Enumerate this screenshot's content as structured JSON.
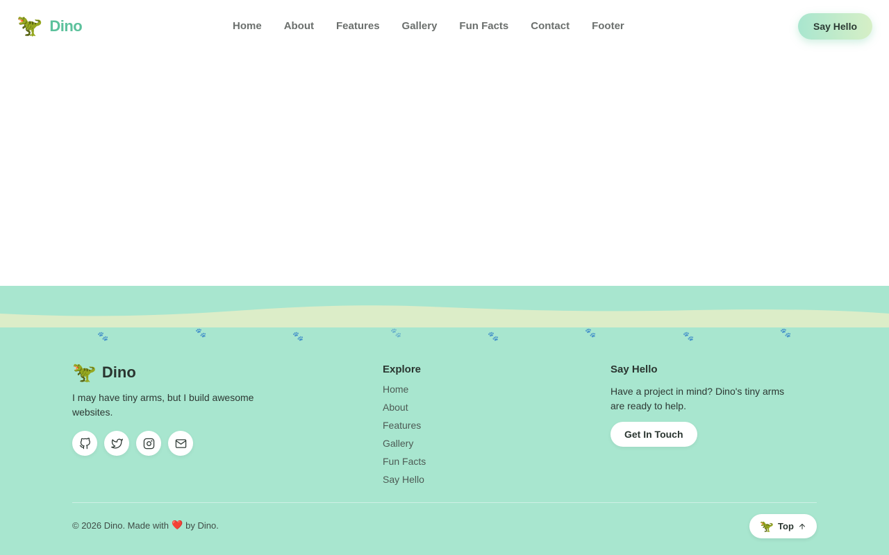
{
  "header": {
    "brand_emoji": "🦖",
    "brand_name": "Dino",
    "nav": [
      "Home",
      "About",
      "Features",
      "Gallery",
      "Fun Facts",
      "Contact",
      "Footer"
    ],
    "cta_label": "Say Hello"
  },
  "footer": {
    "brand_emoji": "🦖",
    "brand_name": "Dino",
    "tagline": "I may have tiny arms, but I build awesome websites.",
    "social_icons": [
      "github-icon",
      "twitter-icon",
      "instagram-icon",
      "mail-icon"
    ],
    "explore_title": "Explore",
    "explore_links": [
      "Home",
      "About",
      "Features",
      "Gallery",
      "Fun Facts",
      "Say Hello"
    ],
    "hello_title": "Say Hello",
    "hello_text": "Have a project in mind? Dino's tiny arms are ready to help.",
    "hello_button": "Get In Touch",
    "copyright_prefix": "© 2026 Dino. Made with",
    "copyright_heart": "❤️",
    "copyright_suffix": "by Dino.",
    "top_emoji": "🦖",
    "top_label": "Top",
    "paw_glyph": "🐾"
  },
  "colors": {
    "brand": "#5cc19c",
    "footer_bg": "#a8e6cf",
    "wave": "#dcedc8",
    "cta_gradient_start": "#a9e6cf",
    "cta_gradient_end": "#d6efc6"
  }
}
